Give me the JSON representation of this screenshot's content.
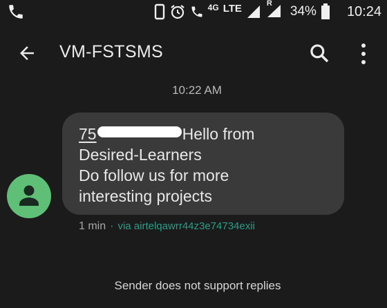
{
  "status_bar": {
    "network_type": "4G",
    "lte": "LTE",
    "roaming": "R",
    "battery": "34%",
    "time": "10:24"
  },
  "app_bar": {
    "title": "VM-FSTSMS",
    "icons": [
      "back-arrow-icon",
      "search-icon",
      "more-vert-icon"
    ]
  },
  "conversation": {
    "timestamp": "10:22 AM",
    "message": {
      "number_prefix": "75",
      "line1_suffix": "Hello from",
      "line2": "Desired-Learners",
      "line3": "Do follow us for more",
      "line4": "interesting projects"
    },
    "meta": {
      "time": "1 min",
      "separator": "·",
      "via": "via airtelqawrr44z3e74734exii"
    },
    "footer_notice": "Sender does not support replies"
  },
  "colors": {
    "background": "#1b1b1b",
    "bubble": "#3a3a3a",
    "avatar": "#5fbf77",
    "via_link": "#2a9d87"
  }
}
